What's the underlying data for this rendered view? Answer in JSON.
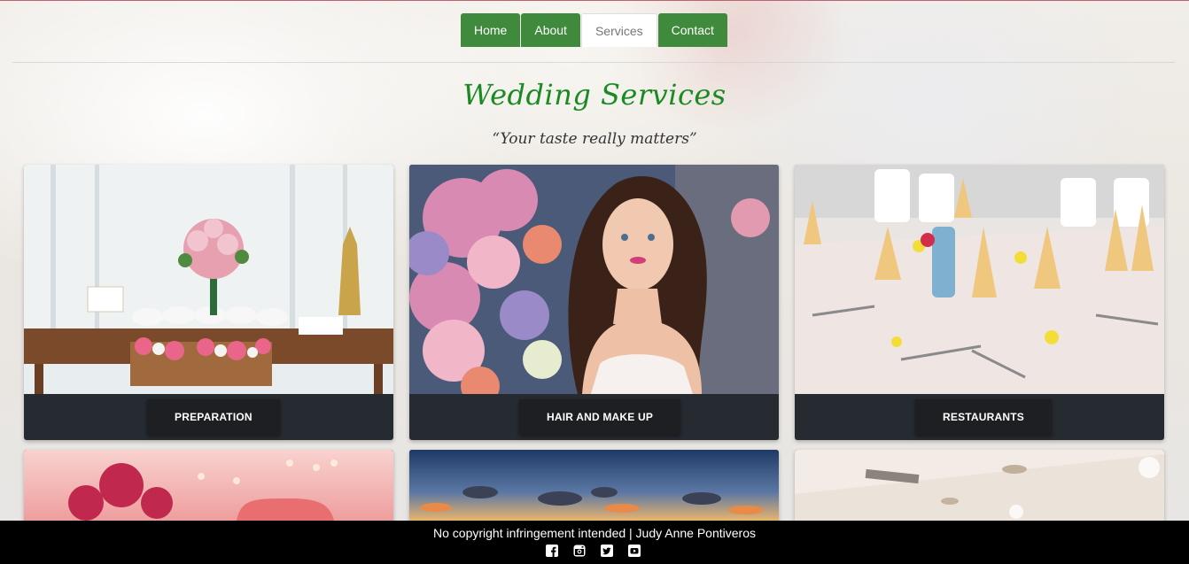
{
  "nav": {
    "items": [
      {
        "label": "Home",
        "active": false
      },
      {
        "label": "About",
        "active": false
      },
      {
        "label": "Services",
        "active": true
      },
      {
        "label": "Contact",
        "active": false
      }
    ]
  },
  "page": {
    "title": "Wedding Services",
    "tagline": "“Your taste really matters”"
  },
  "services": [
    {
      "label": "PREPARATION",
      "image": "wedding preparation table with flowers"
    },
    {
      "label": "HAIR AND MAKE UP",
      "image": "bride with flowers"
    },
    {
      "label": "RESTAURANTS",
      "image": "restaurant table setting"
    },
    {
      "label": "",
      "image": "pink floral cake"
    },
    {
      "label": "",
      "image": "sunset sky"
    },
    {
      "label": "",
      "image": "reception hall ceiling"
    }
  ],
  "footer": {
    "text": "No copyright infringement intended | Judy Anne Pontiveros",
    "icons": [
      "facebook-icon",
      "instagram-icon",
      "twitter-icon",
      "youtube-icon"
    ]
  },
  "colors": {
    "nav_green": "#3f8a3c",
    "title_green": "#1b8a22",
    "card_bg": "#262a31",
    "footer_bg": "#000000"
  }
}
